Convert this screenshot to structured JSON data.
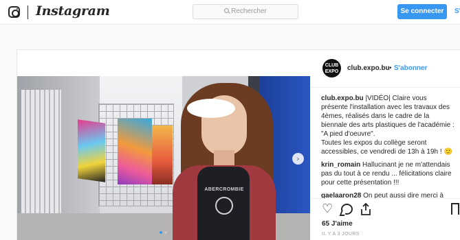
{
  "header": {
    "wordmark": "Instagram",
    "search_placeholder": "Rechercher",
    "login_label": "Se connecter",
    "signup_label": "S'"
  },
  "media": {
    "shirt_text": "ABERCROMBIE",
    "active_slide": 1,
    "slide_count": 2
  },
  "post": {
    "avatar_text": "CLUB EXPO",
    "author": "club.expo.bu",
    "separator": "•",
    "follow_label": "S'abonner",
    "comments": [
      {
        "user": "club.expo.bu",
        "text": "|VIDÉO| Claire vous présente l'installation avec les travaux des 4èmes, réalisés dans le cadre de la biennale des arts plastiques de l'académie : \"A pied d'oeuvre\".",
        "text2": "Toutes les expos du collège seront accessibles, ce vendredi de 13h à 19h ! 🙂"
      },
      {
        "user": "krin_romain",
        "text": "Hallucinant je ne m'attendais pas du tout à ce rendu ... félicitations claire pour cette présentation !!!"
      },
      {
        "user": "gaelaaron28",
        "text": "On peut aussi dire merci à Zoé et Camille pour le montage ! 😉 Merci"
      }
    ],
    "likes": "65 J'aime",
    "timestamp": "IL Y A 3 JOURS"
  },
  "colors": {
    "accent": "#3897f0",
    "text": "#262626",
    "muted": "#999999"
  },
  "icons": [
    "camera-icon",
    "search-icon",
    "heart-icon",
    "comment-icon",
    "share-icon",
    "bookmark-icon",
    "chevron-right-icon"
  ]
}
